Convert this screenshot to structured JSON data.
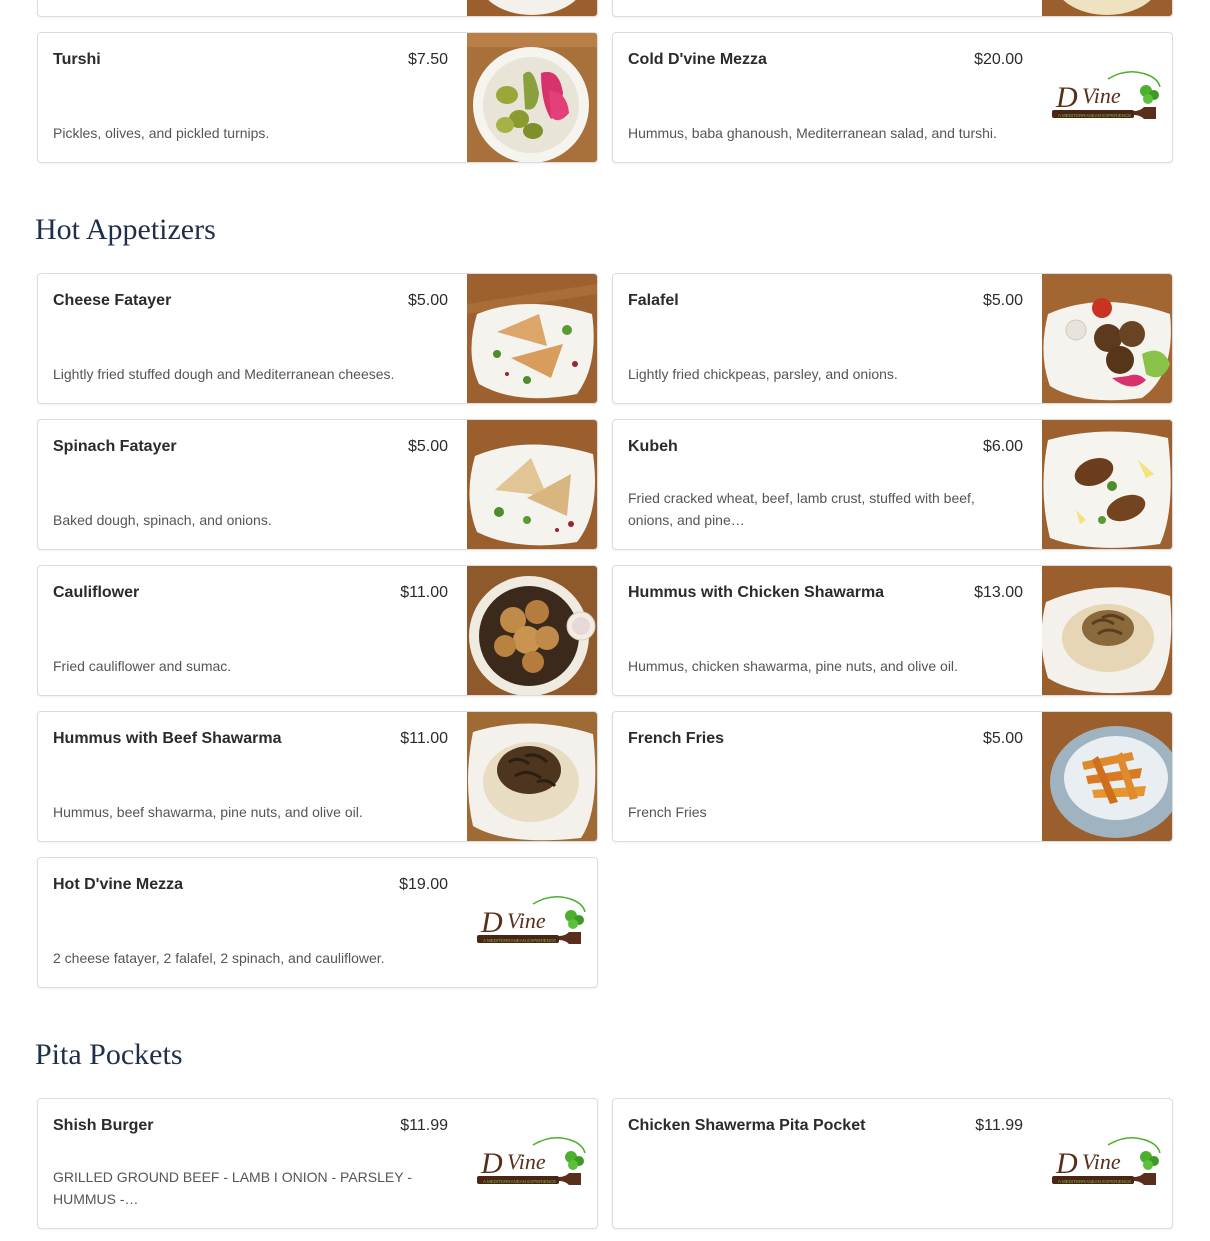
{
  "sections": {
    "hot": "Hot Appetizers",
    "pita": "Pita Pockets"
  },
  "items": {
    "turshi": {
      "name": "Turshi",
      "price": "$7.50",
      "desc": "Pickles, olives, and pickled turnips."
    },
    "cold_mezza": {
      "name": "Cold D'vine Mezza",
      "price": "$20.00",
      "desc": "Hummus, baba ghanoush, Mediterranean salad, and turshi."
    },
    "cheese_fatayer": {
      "name": "Cheese Fatayer",
      "price": "$5.00",
      "desc": "Lightly fried stuffed dough and Mediterranean cheeses."
    },
    "falafel": {
      "name": "Falafel",
      "price": "$5.00",
      "desc": "Lightly fried chickpeas, parsley, and onions."
    },
    "spinach_fatayer": {
      "name": "Spinach Fatayer",
      "price": "$5.00",
      "desc": "Baked dough, spinach, and onions."
    },
    "kubeh": {
      "name": "Kubeh",
      "price": "$6.00",
      "desc": "Fried cracked wheat, beef, lamb crust, stuffed with beef, onions, and pine…"
    },
    "cauliflower": {
      "name": "Cauliflower",
      "price": "$11.00",
      "desc": "Fried cauliflower and sumac."
    },
    "hummus_chicken": {
      "name": "Hummus with Chicken Shawarma",
      "price": "$13.00",
      "desc": "Hummus, chicken shawarma, pine nuts, and olive oil."
    },
    "hummus_beef": {
      "name": "Hummus with Beef Shawarma",
      "price": "$11.00",
      "desc": "Hummus, beef shawarma, pine nuts, and olive oil."
    },
    "fries": {
      "name": "French Fries",
      "price": "$5.00",
      "desc": "French Fries"
    },
    "hot_mezza": {
      "name": "Hot D'vine Mezza",
      "price": "$19.00",
      "desc": "2 cheese fatayer, 2 falafel, 2 spinach, and cauliflower."
    },
    "shish_burger": {
      "name": "Shish Burger",
      "price": "$11.99",
      "desc": "GRILLED GROUND BEEF - LAMB I ONION - PARSLEY - HUMMUS -…"
    },
    "chicken_pita": {
      "name": "Chicken Shawerma Pita Pocket",
      "price": "$11.99",
      "desc": ""
    }
  },
  "logo": {
    "brand": "D'Vine",
    "tagline": "A MEDITERRANEAN EXPERIENCE"
  },
  "colors": {
    "heading": "#1f2f4a",
    "wood": "#9a5f2c",
    "plate": "#f4f1ec",
    "logo_brown": "#5a2e1c",
    "logo_green": "#4caf2e"
  }
}
